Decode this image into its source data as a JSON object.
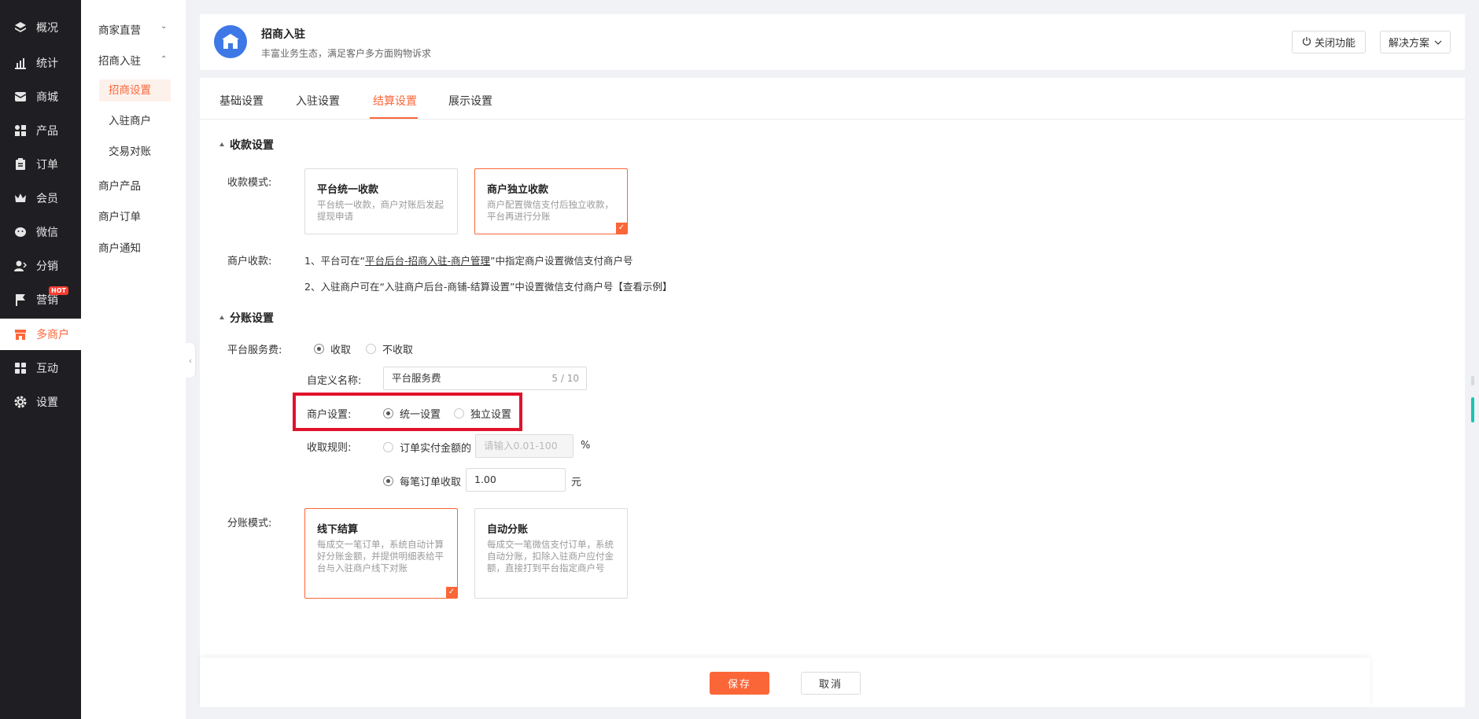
{
  "nav": {
    "items": [
      {
        "label": "概况",
        "icon": "layers-icon"
      },
      {
        "label": "统计",
        "icon": "chart-icon"
      },
      {
        "label": "商城",
        "icon": "mail-icon"
      },
      {
        "label": "产品",
        "icon": "grid-icon"
      },
      {
        "label": "订单",
        "icon": "clipboard-icon"
      },
      {
        "label": "会员",
        "icon": "crown-icon"
      },
      {
        "label": "微信",
        "icon": "wechat-icon"
      },
      {
        "label": "分销",
        "icon": "user-share-icon"
      },
      {
        "label": "营销",
        "icon": "flag-icon"
      },
      {
        "label": "多商户",
        "icon": "store-icon"
      },
      {
        "label": "互动",
        "icon": "apps-icon"
      },
      {
        "label": "设置",
        "icon": "gear-icon"
      }
    ],
    "active": "多商户",
    "hot_badge": "HOT"
  },
  "subnav": {
    "groups": [
      {
        "label": "商家直营"
      },
      {
        "label": "招商入驻"
      }
    ],
    "children": [
      "招商设置",
      "入驻商户",
      "交易对账"
    ],
    "items": [
      "商户产品",
      "商户订单",
      "商户通知"
    ],
    "active": "招商设置"
  },
  "header": {
    "title": "招商入驻",
    "subtitle": "丰富业务生态，满足客户多方面购物诉求",
    "close_btn": "关闭功能",
    "solution_btn": "解决方案"
  },
  "tabs": [
    "基础设置",
    "入驻设置",
    "结算设置",
    "展示设置"
  ],
  "active_tab": "结算设置",
  "collect": {
    "section_title": "收款设置",
    "mode_label": "收款模式:",
    "options": [
      {
        "title": "平台统一收款",
        "desc": "平台统一收款，商户对账后发起提现申请",
        "selected": false
      },
      {
        "title": "商户独立收款",
        "desc": "商户配置微信支付后独立收款，平台再进行分账",
        "selected": true
      }
    ],
    "merchant_label": "商户收款:",
    "line1_pre": "1、平台可在“",
    "line1_link": "平台后台-招商入驻-商户管理",
    "line1_post": "”中指定商户设置微信支付商户号",
    "line2": "2、入驻商户可在“入驻商户后台-商铺-结算设置”中设置微信支付商户号【查看示例】"
  },
  "split": {
    "section_title": "分账设置",
    "fee_label": "平台服务费:",
    "fee_on": "收取",
    "fee_off": "不收取",
    "name_label": "自定义名称:",
    "name_value": "平台服务费",
    "name_count": "5 / 10",
    "merchant_label": "商户设置:",
    "unified": "统一设置",
    "independent": "独立设置",
    "rule_label": "收取规则:",
    "rule_percent": "订单实付金额的",
    "rule_percent_placeholder": "请输入0.01-100",
    "percent_unit": "%",
    "rule_fixed": "每笔订单收取",
    "fixed_value": "1.00",
    "fixed_unit": "元",
    "mode_label": "分账模式:",
    "mode_options": [
      {
        "title": "线下结算",
        "desc": "每成交一笔订单，系统自动计算好分账金额，并提供明细表给平台与入驻商户线下对账",
        "selected": true
      },
      {
        "title": "自动分账",
        "desc": "每成交一笔微信支付订单，系统自动分账，扣除入驻商户应付金额，直接打到平台指定商户号",
        "selected": false
      }
    ]
  },
  "footer": {
    "save": "保存",
    "cancel": "取消"
  },
  "colors": {
    "accent": "#fb6638",
    "nav_bg": "#1f1f23",
    "highlight_box": "#e1122a"
  }
}
